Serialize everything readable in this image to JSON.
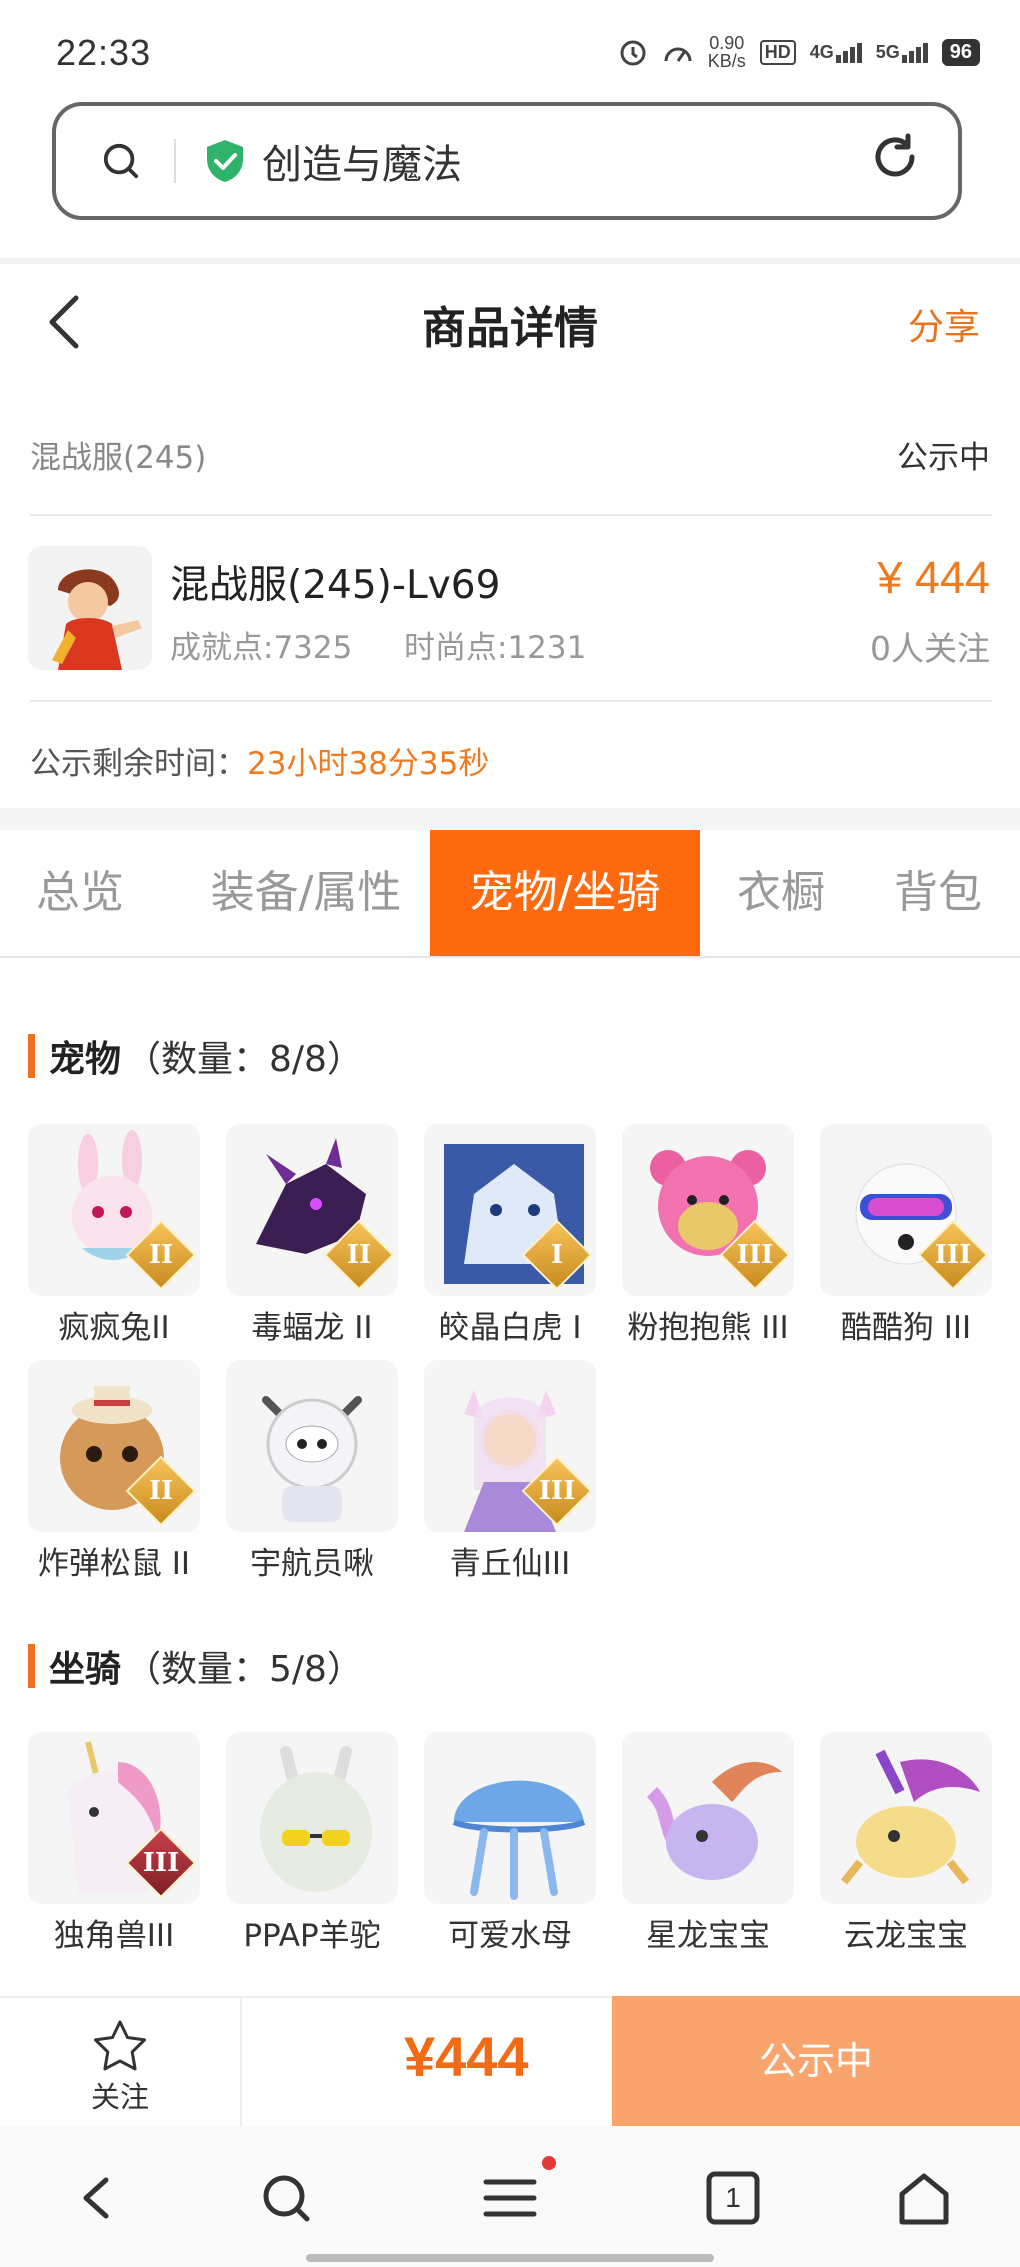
{
  "status_bar": {
    "time": "22:33",
    "speed_value": "0.90",
    "speed_unit": "KB/s",
    "hd": "HD",
    "net1": "4G",
    "net2": "5G",
    "battery": "96"
  },
  "search": {
    "text": "创造与魔法"
  },
  "header": {
    "title": "商品详情",
    "share": "分享"
  },
  "listing": {
    "server": "混战服(245)",
    "status": "公示中",
    "character_name": "混战服(245)-Lv69",
    "achievement": "成就点:7325",
    "fashion": "时尚点:1231",
    "price": "¥ 444",
    "followers": "0人关注",
    "remaining_label": "公示剩余时间：",
    "remaining_value": "23小时38分35秒"
  },
  "tabs": [
    "总览",
    "装备/属性",
    "宠物/坐骑",
    "衣橱",
    "背包"
  ],
  "pets_section": {
    "title": "宠物",
    "count": "（数量：8/8）",
    "items": [
      {
        "name": "疯疯兔II",
        "tier": "II"
      },
      {
        "name": "毒蝠龙 II",
        "tier": "II"
      },
      {
        "name": "皎晶白虎 I",
        "tier": "I"
      },
      {
        "name": "粉抱抱熊 III",
        "tier": "III"
      },
      {
        "name": "酷酷狗 III",
        "tier": "III"
      },
      {
        "name": "炸弹松鼠 II",
        "tier": "II"
      },
      {
        "name": "宇航员啾",
        "tier": ""
      },
      {
        "name": "青丘仙III",
        "tier": "III"
      }
    ]
  },
  "mounts_section": {
    "title": "坐骑",
    "count": "（数量：5/8）",
    "items": [
      {
        "name": "独角兽III",
        "tier": "III"
      },
      {
        "name": "PPAP羊驼",
        "tier": ""
      },
      {
        "name": "可爱水母",
        "tier": ""
      },
      {
        "name": "星龙宝宝",
        "tier": ""
      },
      {
        "name": "云龙宝宝",
        "tier": ""
      }
    ]
  },
  "bottom_bar": {
    "follow_label": "关注",
    "price": "¥444",
    "action": "公示中"
  },
  "nav": {
    "tab_count": "1"
  },
  "colors": {
    "accent": "#ff6a0e",
    "price": "#ef7b21",
    "action_button": "#f8a46c"
  }
}
